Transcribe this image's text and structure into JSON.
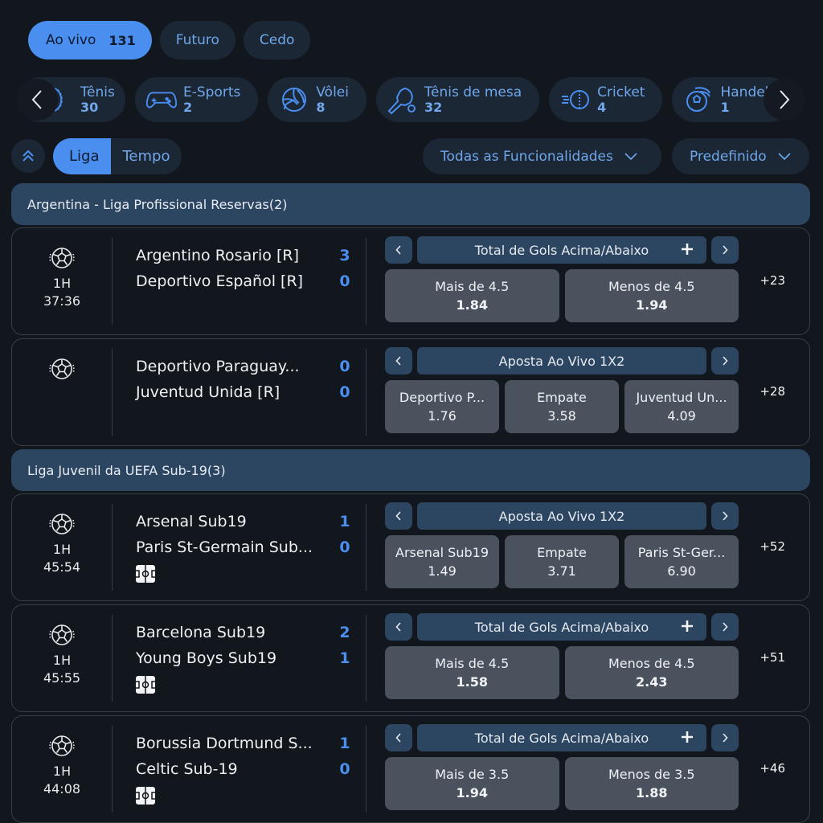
{
  "top_tabs": [
    {
      "label": "Ao vivo",
      "count": "131",
      "active": true
    },
    {
      "label": "Futuro"
    },
    {
      "label": "Cedo"
    }
  ],
  "sports": [
    {
      "name": "Tênis",
      "count": "30",
      "icon": "tennis-icon"
    },
    {
      "name": "E-Sports",
      "count": "2",
      "icon": "gamepad-icon"
    },
    {
      "name": "Vôlei",
      "count": "8",
      "icon": "volleyball-icon"
    },
    {
      "name": "Tênis de mesa",
      "count": "32",
      "icon": "table-tennis-icon"
    },
    {
      "name": "Cricket",
      "count": "4",
      "icon": "cricket-ball-icon"
    },
    {
      "name": "Handeb",
      "count": "1",
      "icon": "handball-icon"
    }
  ],
  "filters": {
    "group_by": [
      {
        "label": "Liga",
        "active": true
      },
      {
        "label": "Tempo"
      }
    ],
    "features_dropdown": "Todas as Funcionalidades",
    "sort_dropdown": "Predefinido"
  },
  "leagues": [
    {
      "title": "Argentina - Liga Profissional Reservas(2)",
      "matches": [
        {
          "phase": "1H",
          "clock": "37:36",
          "stats": false,
          "home": "Argentino Rosario [R]",
          "away": "Deportivo Español [R]",
          "home_score": "3",
          "away_score": "0",
          "market": "Total de Gols Acima/Abaixo",
          "market_plus": true,
          "odds": [
            {
              "label": "Mais de  4.5",
              "value": "1.84"
            },
            {
              "label": "Menos de  4.5",
              "value": "1.94"
            }
          ],
          "more": "+23"
        },
        {
          "phase": "",
          "clock": "",
          "stats": false,
          "home": "Deportivo Paraguay...",
          "away": "Juventud Unida [R]",
          "home_score": "0",
          "away_score": "0",
          "market": "Aposta Ao Vivo 1X2",
          "market_plus": false,
          "odds": [
            {
              "label": "Deportivo P...",
              "value": "1.76"
            },
            {
              "label": "Empate",
              "value": "3.58"
            },
            {
              "label": "Juventud Un...",
              "value": "4.09"
            }
          ],
          "more": "+28"
        }
      ]
    },
    {
      "title": "Liga Juvenil da UEFA Sub-19(3)",
      "matches": [
        {
          "phase": "1H",
          "clock": "45:54",
          "stats": true,
          "home": "Arsenal Sub19",
          "away": "Paris St-Germain Sub...",
          "home_score": "1",
          "away_score": "0",
          "market": "Aposta Ao Vivo 1X2",
          "market_plus": false,
          "odds": [
            {
              "label": "Arsenal Sub19",
              "value": "1.49"
            },
            {
              "label": "Empate",
              "value": "3.71"
            },
            {
              "label": "Paris St-Ger...",
              "value": "6.90"
            }
          ],
          "more": "+52"
        },
        {
          "phase": "1H",
          "clock": "45:55",
          "stats": true,
          "home": "Barcelona Sub19",
          "away": "Young Boys Sub19",
          "home_score": "2",
          "away_score": "1",
          "market": "Total de Gols Acima/Abaixo",
          "market_plus": true,
          "odds": [
            {
              "label": "Mais de  4.5",
              "value": "1.58"
            },
            {
              "label": "Menos de  4.5",
              "value": "2.43"
            }
          ],
          "more": "+51"
        },
        {
          "phase": "1H",
          "clock": "44:08",
          "stats": true,
          "home": "Borussia Dortmund S...",
          "away": "Celtic Sub-19",
          "home_score": "1",
          "away_score": "0",
          "market": "Total de Gols Acima/Abaixo",
          "market_plus": true,
          "odds": [
            {
              "label": "Mais de  3.5",
              "value": "1.94"
            },
            {
              "label": "Menos de  3.5",
              "value": "1.88"
            }
          ],
          "more": "+46"
        }
      ]
    }
  ],
  "colors": {
    "accent": "#4a8ff0",
    "pill_bg": "#1c2735",
    "league_header": "#2c4560",
    "odds_bg": "#4a525e",
    "page_bg": "#12161d"
  }
}
